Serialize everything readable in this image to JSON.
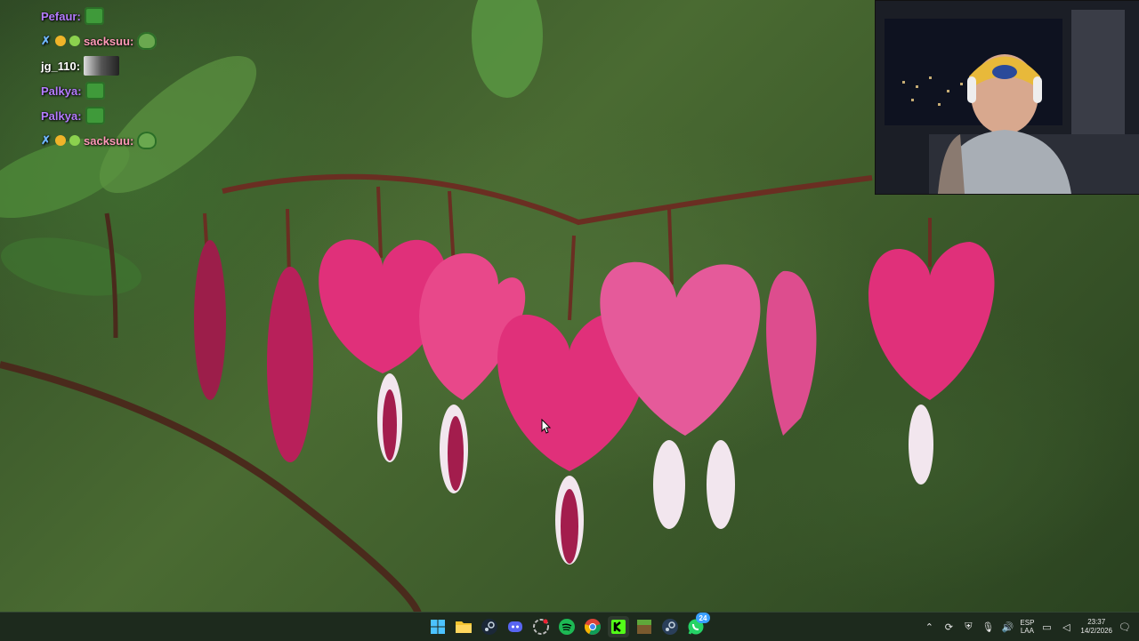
{
  "chat": {
    "lines": [
      {
        "user": "Pefaur:",
        "emote": "pepe-box"
      },
      {
        "user": "sacksuu:",
        "emote": "pepe-frog"
      },
      {
        "user": "jg_110:",
        "emote": "photo"
      },
      {
        "user": "Palkya:",
        "emote": "pepe-box"
      },
      {
        "user": "Palkya:",
        "emote": "pepe-box"
      },
      {
        "user": "sacksuu:",
        "emote": "pepe-frog"
      }
    ]
  },
  "taskbar": {
    "apps": [
      "windows-start",
      "file-explorer",
      "steam",
      "discord",
      "unknown-app",
      "spotify",
      "chrome",
      "kick",
      "minecraft",
      "steam-2",
      "whatsapp"
    ],
    "whatsapp_badge": "24",
    "tray": {
      "lang_top": "ESP",
      "lang_bottom": "LAA",
      "time": "23:37",
      "date": "14/2/2026"
    }
  },
  "colors": {
    "taskbar_bg": "#1d2a1d",
    "chat_name_purple": "#b57cff",
    "chat_name_pink": "#ff9ab8"
  }
}
